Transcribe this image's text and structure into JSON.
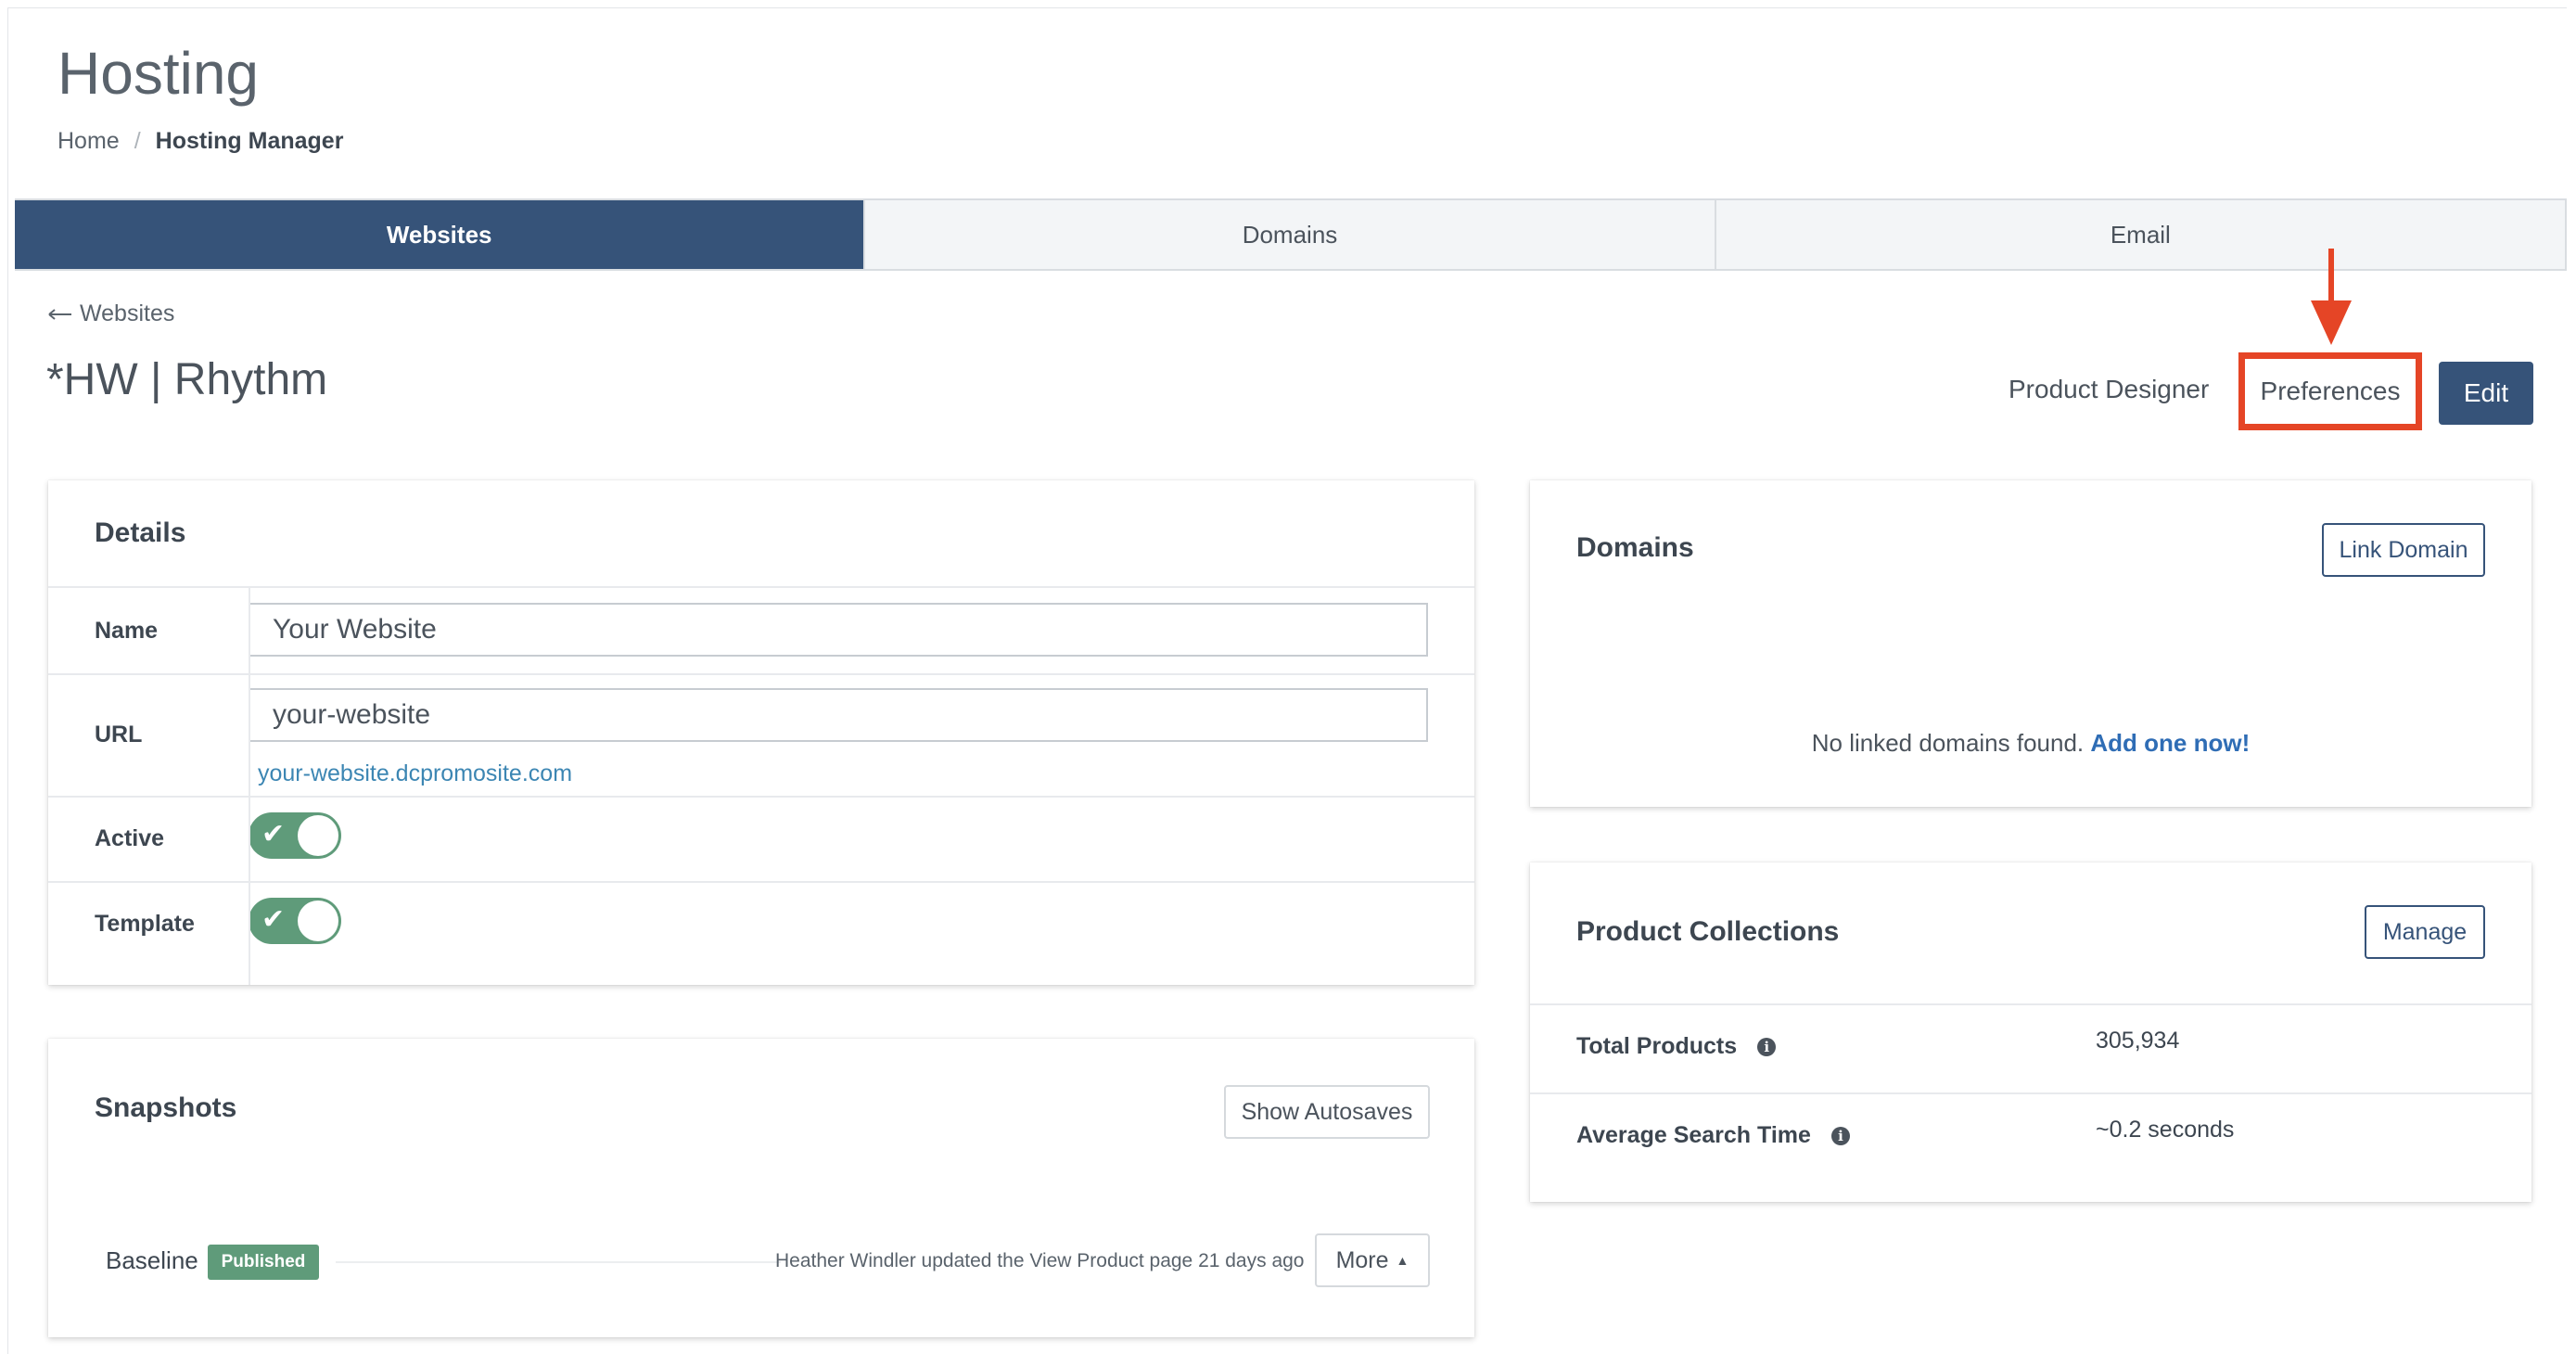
{
  "header": {
    "title": "Hosting",
    "breadcrumb": {
      "home": "Home",
      "separator": "/",
      "current": "Hosting Manager"
    }
  },
  "tabs": [
    {
      "label": "Websites",
      "active": true
    },
    {
      "label": "Domains",
      "active": false
    },
    {
      "label": "Email",
      "active": false
    }
  ],
  "site": {
    "back_label": "Websites",
    "title": "*HW | Rhythm",
    "actions": {
      "product_designer": "Product Designer",
      "preferences": "Preferences",
      "edit": "Edit"
    }
  },
  "details": {
    "title": "Details",
    "name_label": "Name",
    "name_value": "Your Website",
    "url_label": "URL",
    "url_value": "your-website",
    "url_full": "your-website.dcpromosite.com",
    "active_label": "Active",
    "active_on": true,
    "template_label": "Template",
    "template_on": true
  },
  "snapshots": {
    "title": "Snapshots",
    "show_autosaves": "Show Autosaves",
    "items": [
      {
        "name": "Baseline",
        "badge": "Published",
        "info": "Heather Windler updated the View Product page 21 days ago",
        "more": "More"
      }
    ]
  },
  "domains": {
    "title": "Domains",
    "link_button": "Link Domain",
    "empty_text": "No linked domains found.",
    "empty_link": "Add one now!"
  },
  "collections": {
    "title": "Product Collections",
    "manage_button": "Manage",
    "rows": [
      {
        "label": "Total Products",
        "value": "305,934"
      },
      {
        "label": "Average Search Time",
        "value": "~0.2 seconds"
      }
    ]
  },
  "colors": {
    "navy": "#365379",
    "green": "#5f9b7a",
    "highlight": "#e54526",
    "link": "#3c86b3"
  }
}
